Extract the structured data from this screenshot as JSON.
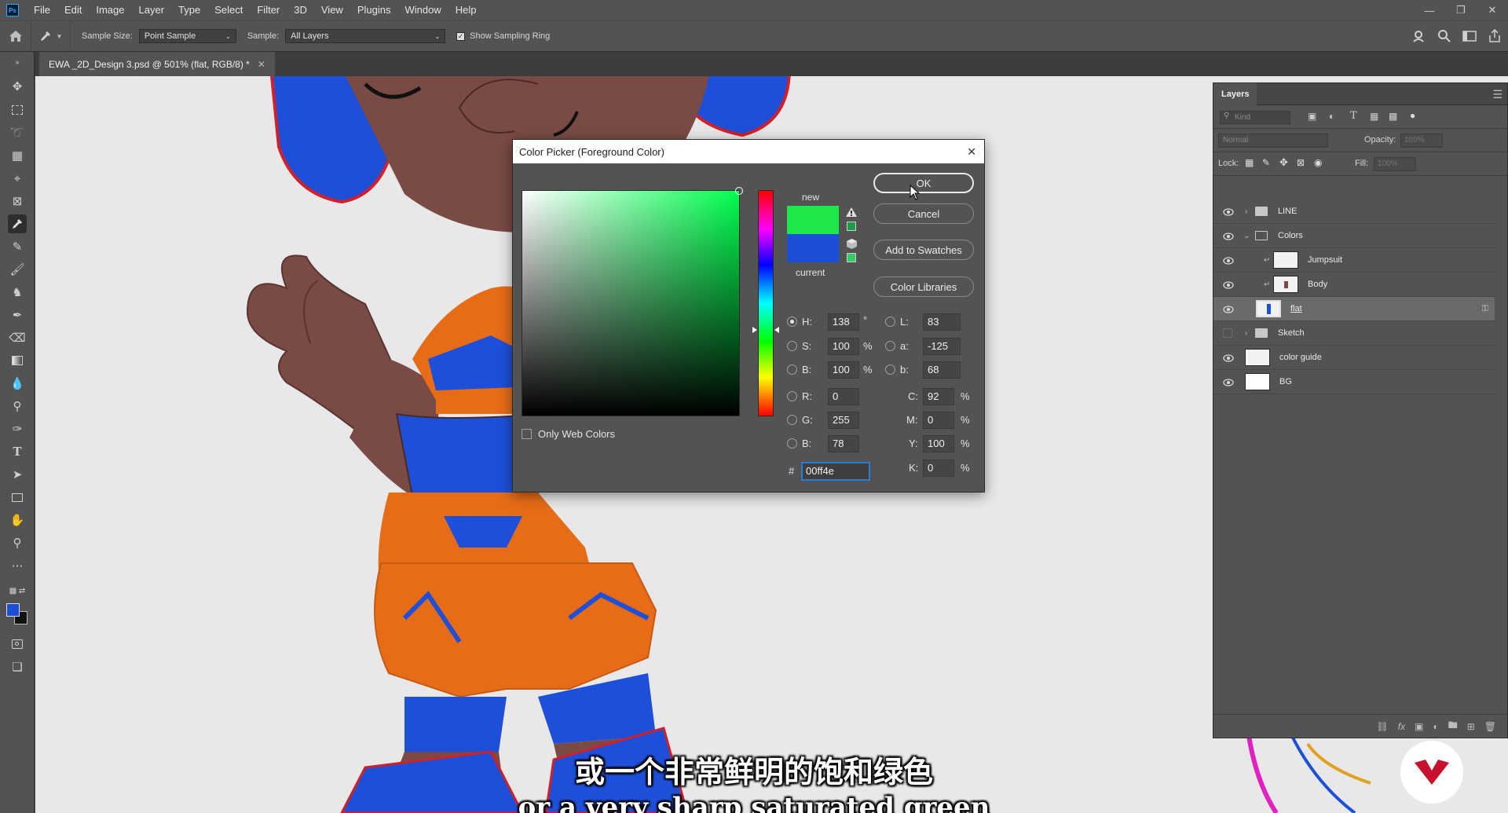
{
  "app": {
    "logo_text": "Ps",
    "menu": [
      "File",
      "Edit",
      "Image",
      "Layer",
      "Type",
      "Select",
      "Filter",
      "3D",
      "View",
      "Plugins",
      "Window",
      "Help"
    ]
  },
  "options": {
    "sample_size_label": "Sample Size:",
    "sample_size_value": "Point Sample",
    "sample_label": "Sample:",
    "sample_value": "All Layers",
    "show_ring_label": "Show Sampling Ring"
  },
  "document": {
    "tab_title": "EWA _2D_Design 3.psd @ 501% (flat, RGB/8) *"
  },
  "color_picker": {
    "title": "Color Picker (Foreground Color)",
    "new_label": "new",
    "current_label": "current",
    "new_color": "#1ee84a",
    "current_color": "#1a4fd6",
    "ok_label": "OK",
    "cancel_label": "Cancel",
    "add_swatches_label": "Add to Swatches",
    "libraries_label": "Color Libraries",
    "only_web_label": "Only Web Colors",
    "hsb": {
      "h_label": "H:",
      "h": "138",
      "h_unit": "°",
      "s_label": "S:",
      "s": "100",
      "s_unit": "%",
      "b_label": "B:",
      "b": "100",
      "b_unit": "%"
    },
    "lab": {
      "l_label": "L:",
      "l": "83",
      "a_label": "a:",
      "a": "-125",
      "b_label": "b:",
      "b": "68"
    },
    "rgb": {
      "r_label": "R:",
      "r": "0",
      "g_label": "G:",
      "g": "255",
      "b_label": "B:",
      "b": "78"
    },
    "cmyk": {
      "c_label": "C:",
      "c": "92",
      "m_label": "M:",
      "m": "0",
      "y_label": "Y:",
      "y": "100",
      "k_label": "K:",
      "k": "0",
      "unit": "%"
    },
    "hex_label": "#",
    "hex": "00ff4e"
  },
  "layers_panel": {
    "title": "Layers",
    "kind_placeholder": "Kind",
    "blend_mode": "Normal",
    "opacity_label": "Opacity:",
    "opacity_value": "100%",
    "lock_label": "Lock:",
    "fill_label": "Fill:",
    "fill_value": "100%",
    "layers": [
      {
        "name": "LINE",
        "type": "group",
        "visible": true
      },
      {
        "name": "Colors",
        "type": "group-open",
        "visible": true
      },
      {
        "name": "Jumpsuit",
        "type": "clipped",
        "visible": true
      },
      {
        "name": "Body",
        "type": "clipped",
        "visible": true
      },
      {
        "name": "flat",
        "type": "layer-selected",
        "visible": true
      },
      {
        "name": "Sketch",
        "type": "group",
        "visible": false
      },
      {
        "name": "color guide",
        "type": "layer",
        "visible": true
      },
      {
        "name": "BG",
        "type": "layer",
        "visible": true
      }
    ]
  },
  "subtitles": {
    "zh": "或一个非常鲜明的饱和绿色",
    "en": "or a very sharp saturated green"
  },
  "colors": {
    "skin": "#7a4b44",
    "blue": "#1e4fd8",
    "orange": "#e66c18",
    "red_line": "#d0202a"
  }
}
